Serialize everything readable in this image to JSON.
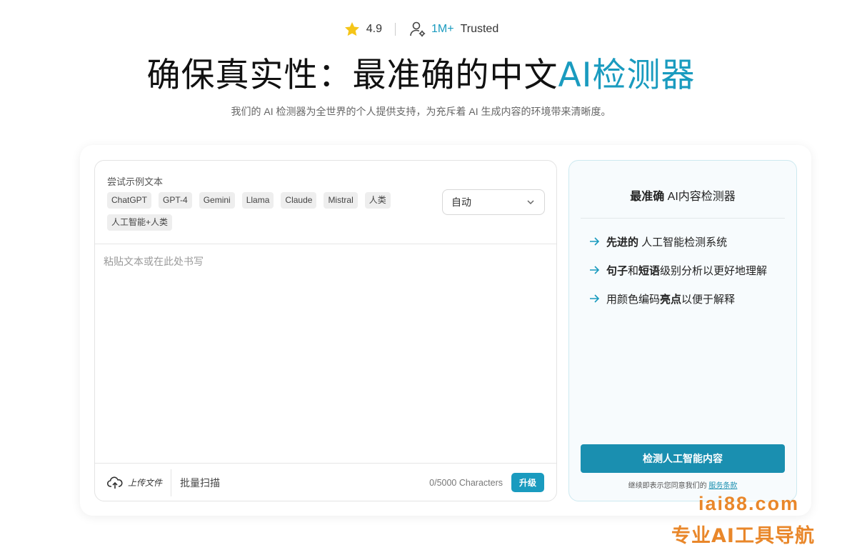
{
  "rating": {
    "score": "4.9",
    "count": "1M+",
    "trusted_label": "Trusted",
    "star_color": "#f5c518"
  },
  "hero": {
    "title_main": "确保真实性：最准确的中文",
    "title_accent": "AI检测器",
    "accent_color": "#1a9bbf",
    "subtitle": "我们的 AI 检测器为全世界的个人提供支持，为充斥着 AI 生成内容的环境带来清晰度。"
  },
  "editor": {
    "sample_label": "尝试示例文本",
    "sample_chips": [
      "ChatGPT",
      "GPT-4",
      "Gemini",
      "Llama",
      "Claude",
      "Mistral",
      "人类",
      "人工智能+人类"
    ],
    "language_select": "自动",
    "placeholder": "粘贴文本或在此处书写",
    "upload_label": "上传文件",
    "batch_label": "批量扫描",
    "char_count": "0/5000 Characters",
    "upgrade_label": "升级"
  },
  "sidebar": {
    "title_bold": "最准确",
    "title_rest": " AI内容检测器",
    "features": [
      {
        "bold": "先进的",
        "rest": " 人工智能检测系统"
      },
      {
        "b1": "句子",
        "m1": "和",
        "b2": "短语",
        "m2": "级别分析以更好地理解"
      },
      {
        "pre": "用颜色编码",
        "bold": "亮点",
        "post": "以便于解释"
      }
    ],
    "detect_button": "检测人工智能内容",
    "terms_text": "继续即表示您同意我们的",
    "terms_link": "服务条款"
  },
  "watermark": {
    "line1": "iai88.com",
    "line2": "专业AI工具导航",
    "color": "#e9872a"
  },
  "icons": {
    "star": "star-icon",
    "user": "user-gear-icon",
    "chevron": "chevron-down-icon",
    "upload": "cloud-upload-icon",
    "arrow": "arrow-right-icon"
  }
}
